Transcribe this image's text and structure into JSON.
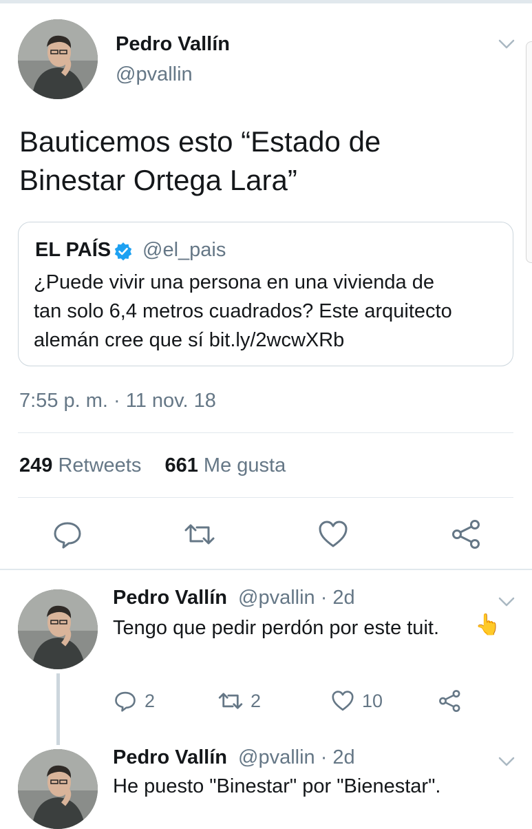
{
  "main_tweet": {
    "author_name": "Pedro Vallín",
    "handle": "@pvallin",
    "text_line1": "Bauticemos esto “Estado de",
    "text_line2": "Binestar Ortega Lara”",
    "quoted": {
      "name": "EL PAÍS",
      "handle": "@el_pais",
      "line1": "¿Puede vivir una persona en una vivienda de",
      "line2": "tan solo 6,4 metros cuadrados? Este arquitecto",
      "line3": "alemán cree que sí bit.ly/2wcwXRb"
    },
    "timestamp": "7:55 p. m. · 11 nov. 18",
    "retweets_count": "249",
    "retweets_label": "Retweets",
    "likes_count": "661",
    "likes_label": "Me gusta"
  },
  "replies": [
    {
      "author_name": "Pedro Vallín",
      "handle_time": "@pvallin · 2d",
      "text": "Tengo que pedir perdón por este tuit.",
      "emoji": "👆",
      "replies_count": "2",
      "retweets_count": "2",
      "likes_count": "10"
    },
    {
      "author_name": "Pedro Vallín",
      "handle_time": "@pvallin · 2d",
      "text": "He puesto \"Binestar\" por \"Bienestar\"."
    }
  ],
  "colors": {
    "text": "#14171a",
    "secondary": "#657786",
    "verified": "#1da1f2",
    "divider": "#e1e8ed"
  }
}
